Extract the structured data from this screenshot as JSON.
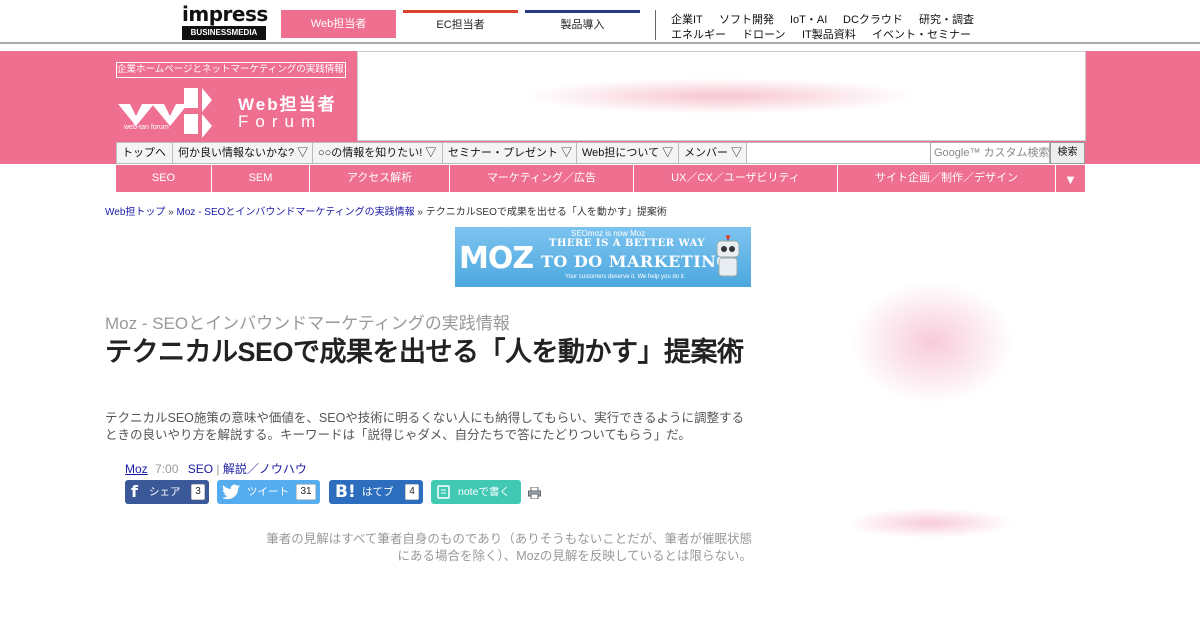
{
  "topbar": {
    "brand_top": "impress",
    "brand_bottom": "BUSINESSMEDIA",
    "tabs": [
      "Web担当者",
      "EC担当者",
      "製品導入"
    ],
    "links_row1": [
      "企業IT",
      "ソフト開発",
      "IoT・AI",
      "DCクラウド",
      "研究・調査"
    ],
    "links_row2": [
      "エネルギー",
      "ドローン",
      "IT製品資料",
      "イベント・セミナー"
    ]
  },
  "header": {
    "tagline": "企業ホームページとネットマーケティングの実践情報サイト",
    "logo_line1": "Web担当者",
    "logo_line2": "Forum",
    "logo_small": "web-tan forum"
  },
  "nav": {
    "items": [
      "トップへ",
      "何か良い情報ないかな? ▽",
      "○○の情報を知りたい! ▽",
      "セミナー・プレゼント ▽",
      "Web担について ▽",
      "メンバー ▽"
    ],
    "search_placeholder": "Google™ カスタム検索",
    "search_button": "検索"
  },
  "categories": [
    "SEO",
    "SEM",
    "アクセス解析",
    "マーケティング／広告",
    "UX／CX／ユーザビリティ",
    "サイト企画／制作／デザイン"
  ],
  "category_more": "▼",
  "breadcrumb": {
    "home": "Web担トップ",
    "sep": " » ",
    "series": "Moz - SEOとインバウンドマーケティングの実践情報",
    "current": "テクニカルSEOで成果を出せる「人を動かす」提案術"
  },
  "ad": {
    "logo": "MOZ",
    "top_line": "SEOmoz is now Moz",
    "line1": "THERE IS A BETTER WAY",
    "line2": "TO DO MARKETING",
    "line3": "Your customers deserve it. We help you do it."
  },
  "article": {
    "series": "Moz - SEOとインバウンドマーケティングの実践情報",
    "title": "テクニカルSEOで成果を出せる「人を動かす」提案術",
    "lead": "テクニカルSEO施策の意味や価値を、SEOや技術に明るくない人にも納得してもらい、実行できるように調整するときの良いやり方を解説する。キーワードは「説得じゃダメ、自分たちで答にたどりついてもらう」だ。",
    "author": "Moz",
    "time": "7:00",
    "category1": "SEO",
    "category_sep": "|",
    "category2": "解説／ノウハウ",
    "disclaimer": "筆者の見解はすべて筆者自身のものであり（ありそうもないことだが、筆者が催眠状態にある場合を除く）、Mozの見解を反映しているとは限らない。"
  },
  "share": {
    "facebook_label": "シェア",
    "facebook_count": "3",
    "twitter_label": "ツイート",
    "twitter_count": "31",
    "hatena_label": "はてブ",
    "hatena_count": "4",
    "note_label": "noteで書く"
  },
  "colors": {
    "brand_pink": "#ef6f91",
    "ec_red": "#d9432d",
    "product_navy": "#273a84",
    "link_blue": "#1a1aa6"
  }
}
